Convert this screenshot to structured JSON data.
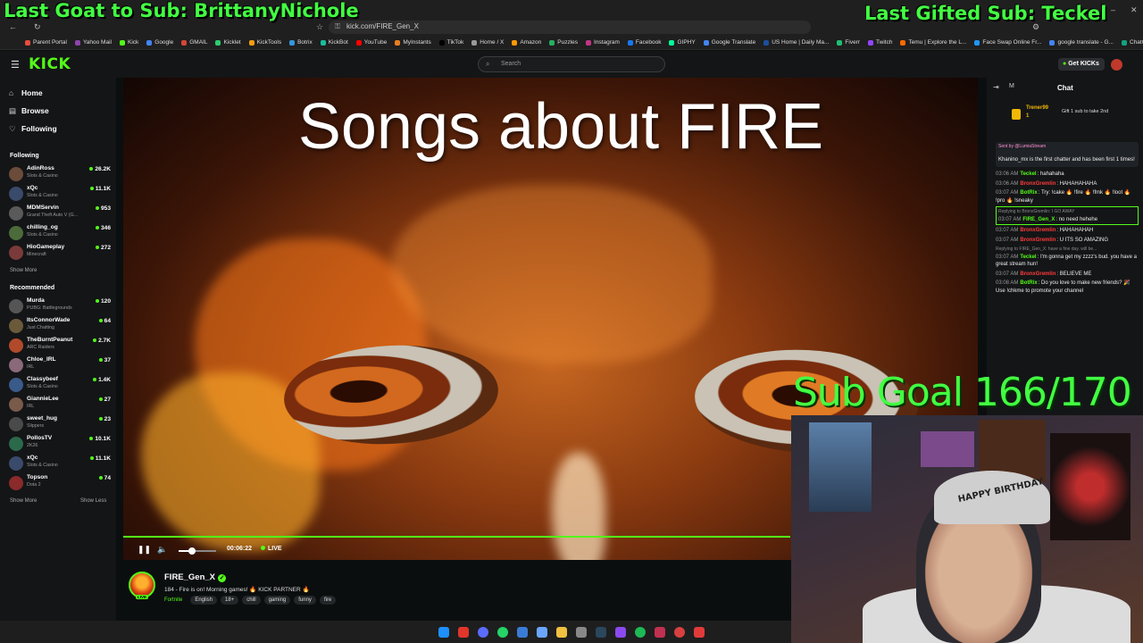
{
  "overlay": {
    "last_goat": "Last Goat to Sub: BrittanyNichole",
    "last_gifted": "Last Gifted Sub: Teckel",
    "sub_goal": "Sub Goal 166/170"
  },
  "browser": {
    "url": "kick.com/FIRE_Gen_X",
    "bookmarks": [
      "Parent Portal",
      "Yahoo Mail",
      "Kick",
      "Google",
      "GMAIL",
      "Kicklet",
      "KickTools",
      "Botrix",
      "KickBot",
      "YouTube",
      "MyInstants",
      "TikTok",
      "Home / X",
      "Amazon",
      "Puzzles",
      "Instagram",
      "Facebook",
      "GIPHY",
      "Google Translate",
      "US Home | Daily Ma...",
      "Fiverr",
      "Twitch",
      "Temu | Explore the L...",
      "Face Swap Online Fr...",
      "google translate - G...",
      "ChatGPT"
    ]
  },
  "header": {
    "logo": "KICK",
    "search_placeholder": "Search",
    "get_kicks": "Get KICKs"
  },
  "sidebar": {
    "nav": [
      {
        "label": "Home",
        "icon": "home-icon"
      },
      {
        "label": "Browse",
        "icon": "browse-icon"
      },
      {
        "label": "Following",
        "icon": "heart-icon"
      }
    ],
    "following_title": "Following",
    "following": [
      {
        "name": "AdinRoss",
        "category": "Slots & Casino",
        "viewers": "26.2K",
        "color": "#6b4b3a"
      },
      {
        "name": "xQc",
        "category": "Slots & Casino",
        "viewers": "11.1K",
        "color": "#3a4a6b"
      },
      {
        "name": "MDMServin",
        "category": "Grand Theft Auto V (G...",
        "viewers": "953",
        "color": "#5a5a5a"
      },
      {
        "name": "chilling_og",
        "category": "Slots & Casino",
        "viewers": "346",
        "color": "#4b6b3a"
      },
      {
        "name": "HioGameplay",
        "category": "Minecraft",
        "viewers": "272",
        "color": "#7a3a3a"
      }
    ],
    "show_more_1": "Show More",
    "recommended_title": "Recommended",
    "recommended": [
      {
        "name": "Murda",
        "category": "PUBG: Battlegrounds",
        "viewers": "120",
        "color": "#555"
      },
      {
        "name": "ItsConnorWade",
        "category": "Just Chatting",
        "viewers": "64",
        "color": "#6b5a3a"
      },
      {
        "name": "TheBurntPeanut",
        "category": "ARC Raiders",
        "viewers": "2.7K",
        "color": "#b04a2a"
      },
      {
        "name": "Chloe_IRL",
        "category": "IRL",
        "viewers": "37",
        "color": "#8a6a7a"
      },
      {
        "name": "Classybeef",
        "category": "Slots & Casino",
        "viewers": "1.4K",
        "color": "#3a5a8a"
      },
      {
        "name": "GiannieLee",
        "category": "IRL",
        "viewers": "27",
        "color": "#7a5a4a"
      },
      {
        "name": "sweet_hug",
        "category": "Slippers",
        "viewers": "23",
        "color": "#4a4a4a"
      },
      {
        "name": "PollosTV",
        "category": "2K26",
        "viewers": "10.1K",
        "color": "#2a6a4a"
      },
      {
        "name": "xQc",
        "category": "Slots & Casino",
        "viewers": "11.1K",
        "color": "#3a4a6b"
      },
      {
        "name": "Topson",
        "category": "Dota 2",
        "viewers": "74",
        "color": "#8a2a2a"
      }
    ],
    "show_more_2": "Show More",
    "show_less": "Show Less"
  },
  "player": {
    "title_overlay": "Songs about FIRE",
    "time": "00:06:22",
    "live": "LIVE",
    "volume": 0.35
  },
  "stream": {
    "live_badge": "LIVE",
    "channel": "FIRE_Gen_X",
    "title": "184 - Fire is on! Morning games! 🔥 KICK PARTNER 🔥",
    "category": "Fortnite",
    "tags": [
      "English",
      "18+",
      "chill",
      "gaming",
      "funny",
      "fire"
    ]
  },
  "chat": {
    "title": "Chat",
    "pinned_user": "Trener99",
    "pinned_count": "1",
    "gift_text": "Gift 1 sub to take 2nd",
    "sent_by": "Sent by @LumiaStream",
    "sent_msg": "Khanino_mx is the first chatter and has been first 1 times!",
    "messages": [
      {
        "time": "03:06 AM",
        "user": "Teckel",
        "color": "#53fc18",
        "text": "hahahaha",
        "reply": ""
      },
      {
        "time": "03:06 AM",
        "user": "BronxGremlin",
        "color": "#ff3b3b",
        "text": "HAHAHAHAHA",
        "reply": ""
      },
      {
        "time": "03:07 AM",
        "user": "BotRix",
        "color": "#53fc18",
        "text": "Try: !cake 🔥 !fire 🔥 !fmk 🔥 !loot 🔥 !pro 🔥 !sneaky",
        "reply": ""
      },
      {
        "time": "03:07 AM",
        "user": "FIRE_Gen_X",
        "color": "#53fc18",
        "text": "no need hehehe",
        "reply": "Replying to BronxGremlin: I GO AWAY"
      },
      {
        "time": "03:07 AM",
        "user": "BronxGremlin",
        "color": "#ff3b3b",
        "text": "HAHAHAHAH",
        "reply": ""
      },
      {
        "time": "03:07 AM",
        "user": "BronxGremlin",
        "color": "#ff3b3b",
        "text": "U ITS SO AMAZING",
        "reply": ""
      },
      {
        "time": "03:07 AM",
        "user": "Teckel",
        "color": "#53fc18",
        "text": "I'm gonna get my zzzz's bud. you have a great stream hun!",
        "reply": "Replying to FIRE_Gen_X: have a fine day. will be..."
      },
      {
        "time": "03:07 AM",
        "user": "BronxGremlin",
        "color": "#ff3b3b",
        "text": "BELIEVE ME",
        "reply": ""
      },
      {
        "time": "03:08 AM",
        "user": "BotRix",
        "color": "#53fc18",
        "text": "Do you love to make new friends? 🎉 Use !chkme to promote your channel",
        "reply": ""
      }
    ]
  },
  "webcam": {
    "cap_text": "HAPPY BIRTHDAY"
  }
}
